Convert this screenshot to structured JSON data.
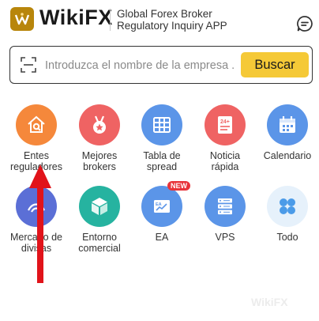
{
  "header": {
    "brand": "WikiFX",
    "tagline_line1": "Global Forex Broker",
    "tagline_line2": "Regulatory Inquiry APP"
  },
  "search": {
    "placeholder": "Introduzca el nombre de la empresa ...",
    "button_label": "Buscar"
  },
  "grid": {
    "items": [
      {
        "label_l1": "Entes",
        "label_l2": "reguladores",
        "color": "#f5883b",
        "icon": "house-search-icon"
      },
      {
        "label_l1": "Mejores",
        "label_l2": "brokers",
        "color": "#ef6363",
        "icon": "medal-icon"
      },
      {
        "label_l1": "Tabla de",
        "label_l2": "spread",
        "color": "#5b95e8",
        "icon": "table-icon"
      },
      {
        "label_l1": "Noticia",
        "label_l2": "rápida",
        "color": "#ef6363",
        "icon": "news-24h-icon"
      },
      {
        "label_l1": "Calendario",
        "label_l2": "",
        "color": "#5b95e8",
        "icon": "calendar-icon"
      },
      {
        "label_l1": "Mercado de",
        "label_l2": "divisas",
        "color": "#5b6fd6",
        "icon": "currency-icon"
      },
      {
        "label_l1": "Entorno",
        "label_l2": "comercial",
        "color": "#26b3a0",
        "icon": "cube-icon"
      },
      {
        "label_l1": "EA",
        "label_l2": "",
        "color": "#5b95e8",
        "icon": "ea-chart-icon",
        "badge": "NEW"
      },
      {
        "label_l1": "VPS",
        "label_l2": "",
        "color": "#5b95e8",
        "icon": "server-icon"
      },
      {
        "label_l1": "Todo",
        "label_l2": "",
        "color": "#e6f1fb",
        "icon": "all-grid-icon"
      }
    ]
  },
  "watermark": "WikiFX"
}
